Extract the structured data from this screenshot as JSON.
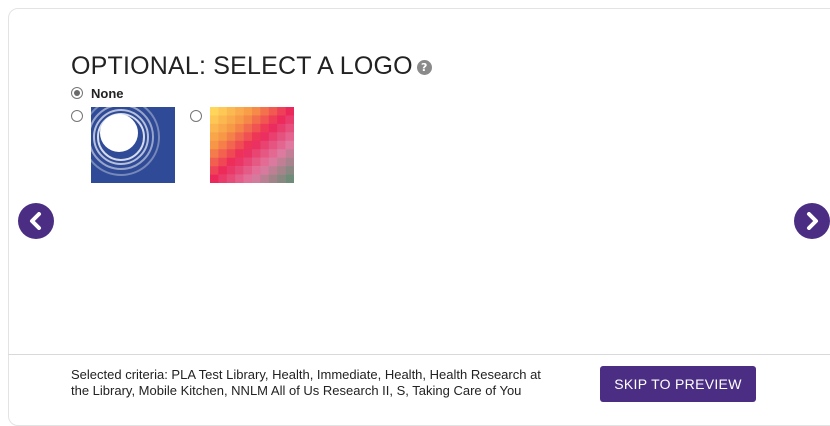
{
  "logo_selection": {
    "title": "OPTIONAL: SELECT A LOGO",
    "help_icon_glyph": "?",
    "help_icon": "question-circle-icon",
    "options": [
      {
        "label": "None",
        "selected": true
      },
      {
        "label": "",
        "logo": "nnlm-circles-logo",
        "selected": false
      },
      {
        "label": "",
        "logo": "gradient-grid-logo",
        "selected": false
      }
    ]
  },
  "navigation": {
    "prev_icon": "chevron-left-icon",
    "next_icon": "chevron-right-icon"
  },
  "footer": {
    "criteria_text": "Selected criteria: PLA Test Library, Health, Immediate, Health, Health Research at the Library, Mobile Kitchen, NNLM All of Us Research II, S, Taking Care of You",
    "skip_button_label": "SKIP TO PREVIEW"
  },
  "colors": {
    "accent": "#4b2e83",
    "logo_blue": "#2f4a96"
  }
}
